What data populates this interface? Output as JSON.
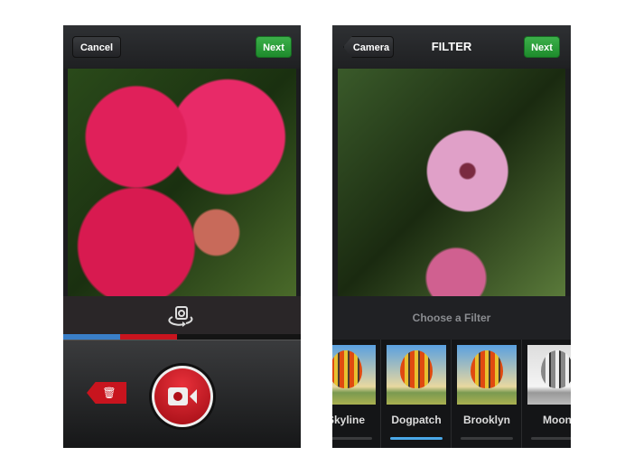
{
  "camera": {
    "cancel_label": "Cancel",
    "next_label": "Next",
    "flip_icon": "camera-flip-icon",
    "delete_icon": "trash-icon",
    "record_icon": "video-camera-icon",
    "progress": {
      "segments": [
        {
          "color": "#3a7fc8",
          "fraction": 0.24
        },
        {
          "color": "#c8141e",
          "fraction": 0.24
        }
      ]
    }
  },
  "filter": {
    "back_label": "Camera",
    "title": "FILTER",
    "next_label": "Next",
    "choose_label": "Choose a Filter",
    "filters": [
      {
        "name": "Skyline",
        "selected": false
      },
      {
        "name": "Dogpatch",
        "selected": true
      },
      {
        "name": "Brooklyn",
        "selected": false
      },
      {
        "name": "Moon",
        "selected": false
      }
    ]
  },
  "colors": {
    "accent_green": "#2a9c38",
    "record_red": "#c8141e",
    "selected_blue": "#4aa8e8"
  }
}
